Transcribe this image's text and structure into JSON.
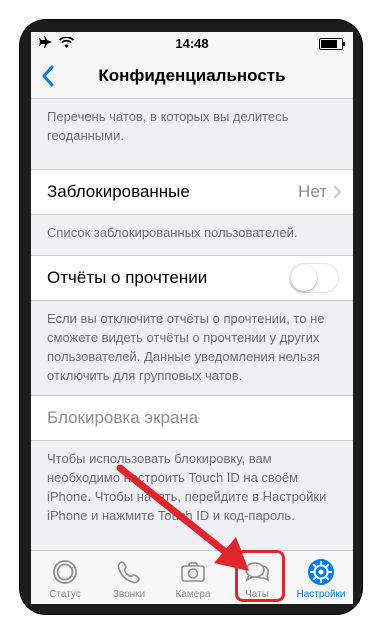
{
  "status_bar": {
    "time": "14:48",
    "battery_level": 0.9
  },
  "nav": {
    "title": "Конфиденциальность",
    "back_icon": "chevron-left-icon"
  },
  "sections": {
    "location_note": "Перечень чатов, в которых вы делитесь геоданными.",
    "blocked": {
      "label": "Заблокированные",
      "value": "Нет"
    },
    "blocked_note": "Список заблокированных пользователей.",
    "read_receipts": {
      "label": "Отчёты о прочтении",
      "enabled": false
    },
    "read_receipts_note": "Если вы отключите отчёты о прочтении, то не сможете видеть отчёты о прочтении у других пользователей. Данные уведомления нельзя отключить для групповых чатов.",
    "screen_lock": {
      "label": "Блокировка экрана"
    },
    "screen_lock_note": "Чтобы использовать блокировку, вам необходимо настроить Touch ID на своём iPhone. Чтобы начать, перейдите в Настройки iPhone и нажмите Touch ID и код-пароль."
  },
  "tabbar": {
    "items": [
      {
        "label": "Статус",
        "icon": "status-icon"
      },
      {
        "label": "Звонки",
        "icon": "phone-icon"
      },
      {
        "label": "Камера",
        "icon": "camera-icon"
      },
      {
        "label": "Чаты",
        "icon": "chats-icon"
      },
      {
        "label": "Настройки",
        "icon": "settings-icon",
        "active": true
      }
    ]
  },
  "colors": {
    "accent": "#007aff",
    "annotation": "#e0262c"
  }
}
